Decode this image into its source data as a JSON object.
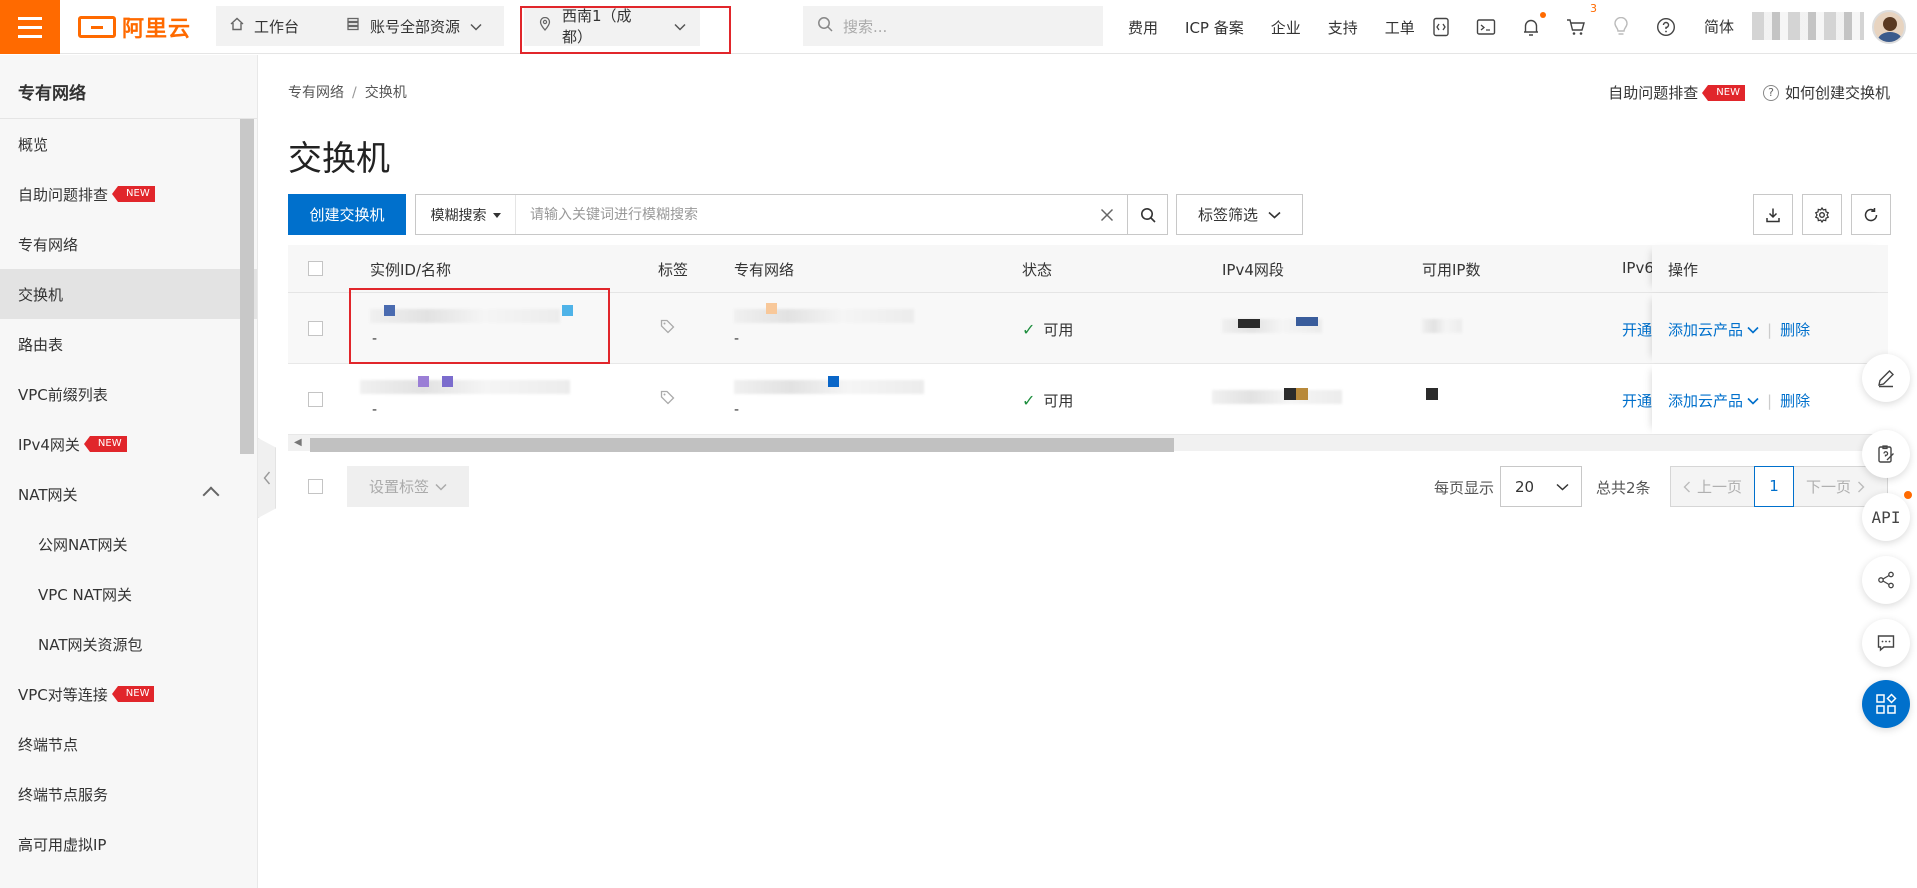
{
  "topbar": {
    "logo_text": "阿里云",
    "workbench": "工作台",
    "resources": "账号全部资源",
    "region": "西南1（成都）",
    "search_placeholder": "搜索...",
    "links": [
      "费用",
      "ICP 备案",
      "企业",
      "支持",
      "工单"
    ],
    "cart_count": "3",
    "lang": "简体"
  },
  "sidebar": {
    "title": "专有网络",
    "items": [
      {
        "label": "概览"
      },
      {
        "label": "自助问题排查",
        "badge": "NEW"
      },
      {
        "label": "专有网络"
      },
      {
        "label": "交换机"
      },
      {
        "label": "路由表"
      },
      {
        "label": "VPC前缀列表"
      },
      {
        "label": "IPv4网关",
        "badge": "NEW"
      },
      {
        "label": "NAT网关"
      },
      {
        "label": "公网NAT网关"
      },
      {
        "label": "VPC NAT网关"
      },
      {
        "label": "NAT网关资源包"
      },
      {
        "label": "VPC对等连接",
        "badge": "NEW"
      },
      {
        "label": "终端节点"
      },
      {
        "label": "终端节点服务"
      },
      {
        "label": "高可用虚拟IP"
      }
    ]
  },
  "breadcrumb": [
    "专有网络",
    "交换机"
  ],
  "top_links": {
    "troubleshoot": "自助问题排查",
    "troubleshoot_badge": "NEW",
    "how_to": "如何创建交换机"
  },
  "page_title": "交换机",
  "toolbar": {
    "create": "创建交换机",
    "search_type": "模糊搜索",
    "search_placeholder": "请输入关键词进行模糊搜索",
    "tag_filter": "标签筛选"
  },
  "table": {
    "columns": [
      "实例ID/名称",
      "标签",
      "专有网络",
      "状态",
      "IPv4网段",
      "可用IP数",
      "IPv6",
      "操作"
    ],
    "rows": [
      {
        "name": "-",
        "vpc_name": "-",
        "status": "可用",
        "ipv6_action": "开通",
        "op_add": "添加云产品",
        "op_delete": "删除"
      },
      {
        "name": "-",
        "vpc_name": "-",
        "status": "可用",
        "ipv6_action": "开通",
        "op_add": "添加云产品",
        "op_delete": "删除"
      }
    ]
  },
  "footer": {
    "set_tags": "设置标签",
    "per_page_label": "每页显示",
    "page_size": "20",
    "total": "总共2条",
    "prev": "上一页",
    "current_page": "1",
    "next": "下一页"
  },
  "float": {
    "api_label": "API"
  },
  "colors": {
    "brand": "#ff6a00",
    "primary": "#0070cc",
    "highlight": "#e1262b",
    "success": "#1e8e3e"
  }
}
